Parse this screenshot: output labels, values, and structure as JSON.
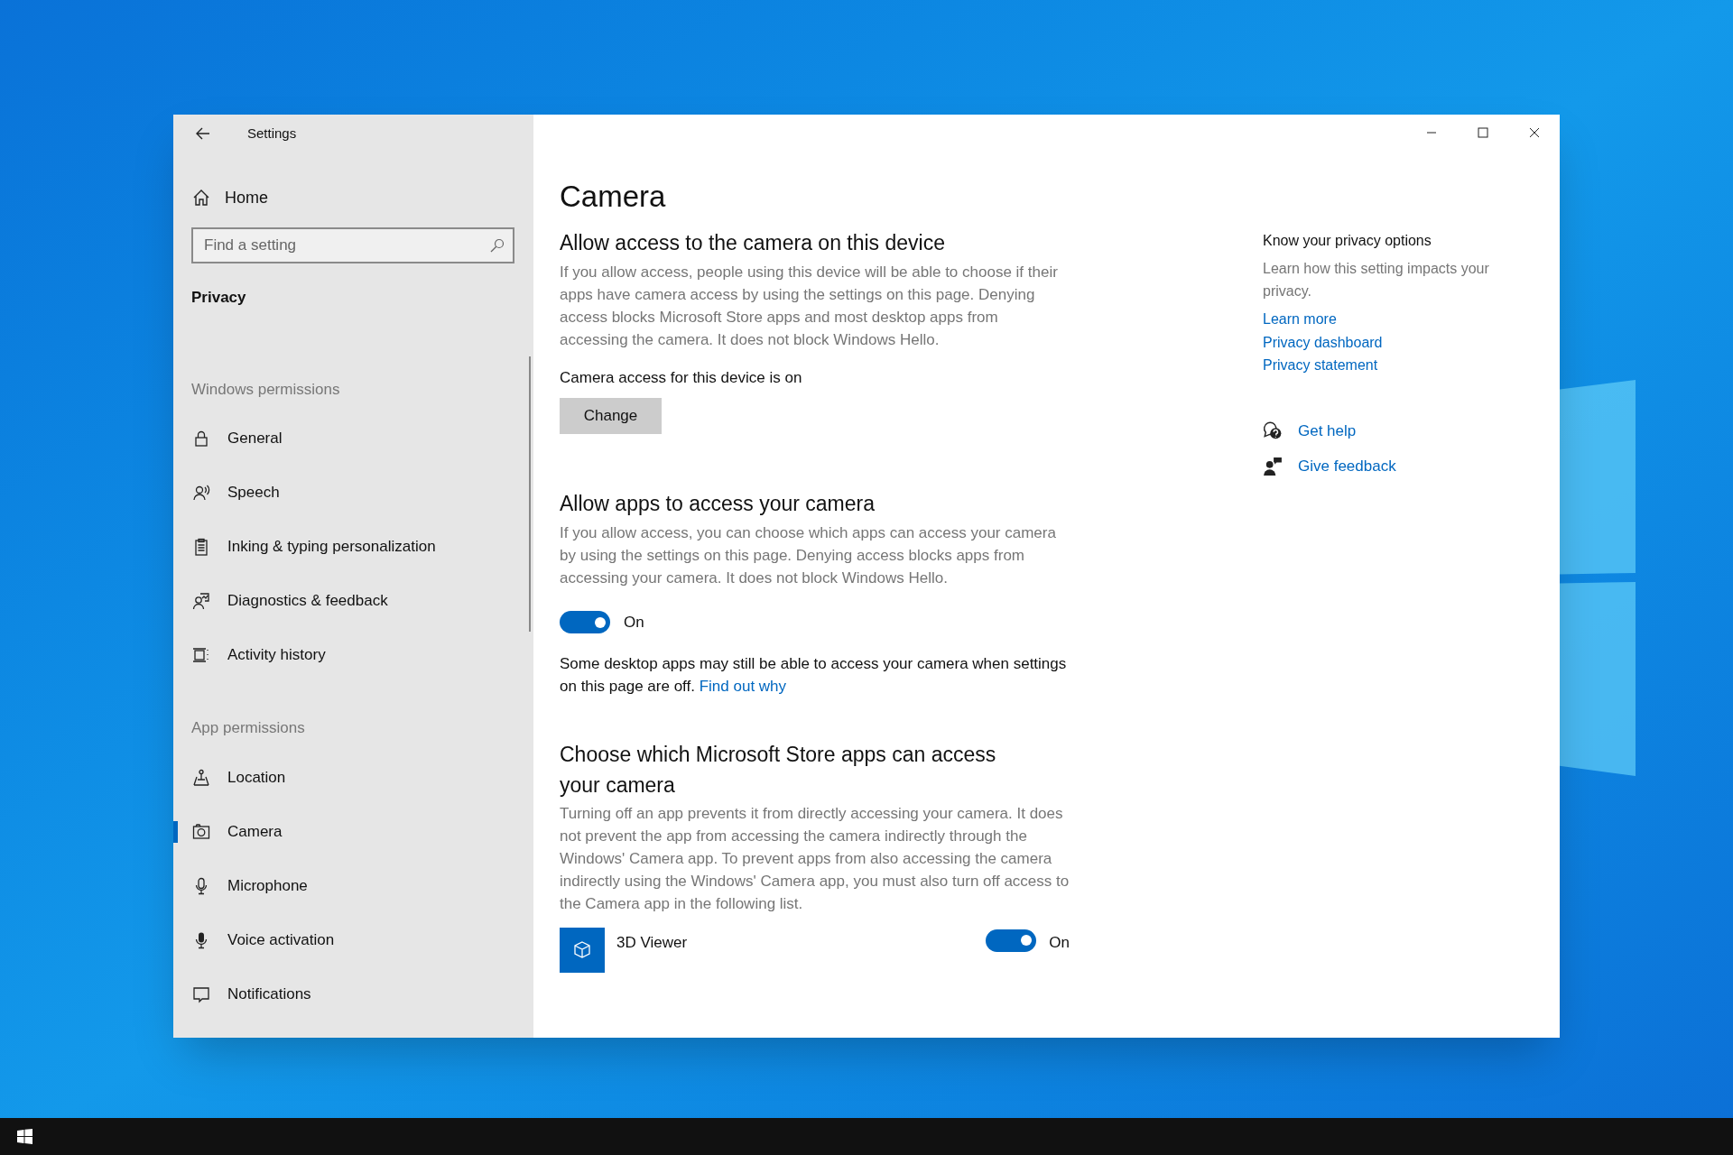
{
  "window": {
    "title": "Settings"
  },
  "sidebar": {
    "home": "Home",
    "search": {
      "placeholder": "Find a setting"
    },
    "section_title": "Privacy",
    "groups": [
      {
        "heading": "Windows permissions",
        "items": [
          {
            "label": "General",
            "kind": "lock",
            "selected": false
          },
          {
            "label": "Speech",
            "kind": "speech",
            "selected": false
          },
          {
            "label": "Inking & typing personalization",
            "kind": "clipboard",
            "selected": false
          },
          {
            "label": "Diagnostics & feedback",
            "kind": "diagnostics",
            "selected": false
          },
          {
            "label": "Activity history",
            "kind": "activity",
            "selected": false
          }
        ]
      },
      {
        "heading": "App permissions",
        "items": [
          {
            "label": "Location",
            "kind": "location",
            "selected": false
          },
          {
            "label": "Camera",
            "kind": "camera",
            "selected": true
          },
          {
            "label": "Microphone",
            "kind": "microphone",
            "selected": false
          },
          {
            "label": "Voice activation",
            "kind": "voice",
            "selected": false
          },
          {
            "label": "Notifications",
            "kind": "notifications",
            "selected": false
          }
        ]
      }
    ]
  },
  "main": {
    "title": "Camera",
    "device_section": {
      "heading": "Allow access to the camera on this device",
      "description": "If you allow access, people using this device will be able to choose if their apps have camera access by using the settings on this page. Denying access blocks Microsoft Store apps and most desktop apps from accessing the camera. It does not block Windows Hello.",
      "status": "Camera access for this device is on",
      "button": "Change"
    },
    "apps_section": {
      "heading": "Allow apps to access your camera",
      "description": "If you allow access, you can choose which apps can access your camera by using the settings on this page. Denying access blocks apps from accessing your camera. It does not block Windows Hello.",
      "toggle": {
        "on": true,
        "label": "On"
      },
      "note": "Some desktop apps may still be able to access your camera when settings on this page are off.",
      "note_link": "Find out why"
    },
    "store_section": {
      "heading": "Choose which Microsoft Store apps can access your camera",
      "description": "Turning off an app prevents it from directly accessing your camera. It does not prevent the app from accessing the camera indirectly through the Windows' Camera app. To prevent apps from also accessing the camera indirectly using the Windows' Camera app, you must also turn off access to the Camera app in the following list.",
      "apps": [
        {
          "name": "3D Viewer",
          "on": true,
          "state_label": "On"
        }
      ]
    }
  },
  "aside": {
    "title": "Know your privacy options",
    "description": "Learn how this setting impacts your privacy.",
    "links": [
      "Learn more",
      "Privacy dashboard",
      "Privacy statement"
    ],
    "help": [
      {
        "label": "Get help",
        "kind": "help"
      },
      {
        "label": "Give feedback",
        "kind": "feedback"
      }
    ]
  }
}
